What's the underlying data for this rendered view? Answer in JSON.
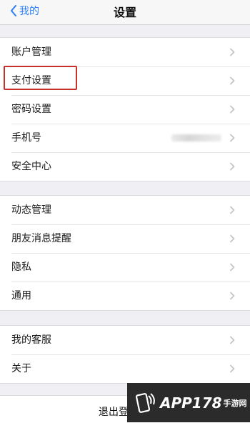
{
  "nav": {
    "back_label": "我的",
    "title": "设置"
  },
  "groups": [
    {
      "items": [
        {
          "label": "账户管理"
        },
        {
          "label": "支付设置"
        },
        {
          "label": "密码设置"
        },
        {
          "label": "手机号"
        },
        {
          "label": "安全中心"
        }
      ]
    },
    {
      "items": [
        {
          "label": "动态管理"
        },
        {
          "label": "朋友消息提醒"
        },
        {
          "label": "隐私"
        },
        {
          "label": "通用"
        }
      ]
    },
    {
      "items": [
        {
          "label": "我的客服"
        },
        {
          "label": "关于"
        }
      ]
    }
  ],
  "logout": {
    "label": "退出登"
  },
  "watermark": {
    "brand": "APP178",
    "sub": "手游网"
  },
  "colors": {
    "accent": "#2c7ff6",
    "highlight": "#c9302c",
    "background": "#efeff4"
  },
  "icons": {
    "back": "chevron-left-icon",
    "row": "chevron-right-icon"
  }
}
